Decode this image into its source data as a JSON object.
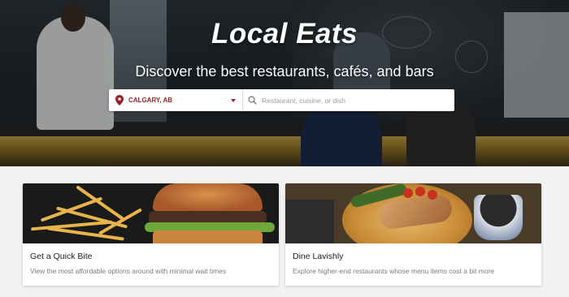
{
  "hero": {
    "title": "Local Eats",
    "subtitle": "Discover the best restaurants, cafés, and bars"
  },
  "search": {
    "location": "CALGARY, AB",
    "query_placeholder": "Restaurant, cuisine, or dish",
    "query_value": ""
  },
  "cards": [
    {
      "title": "Get a Quick Bite",
      "description": "View the most affordable options around with minimal wait times"
    },
    {
      "title": "Dine Lavishly",
      "description": "Explore higher-end restaurants whose menu items cost a bit more"
    }
  ],
  "colors": {
    "accent": "#9c1f24",
    "card_bg": "#ffffff",
    "page_bg": "#f2f2f2"
  }
}
